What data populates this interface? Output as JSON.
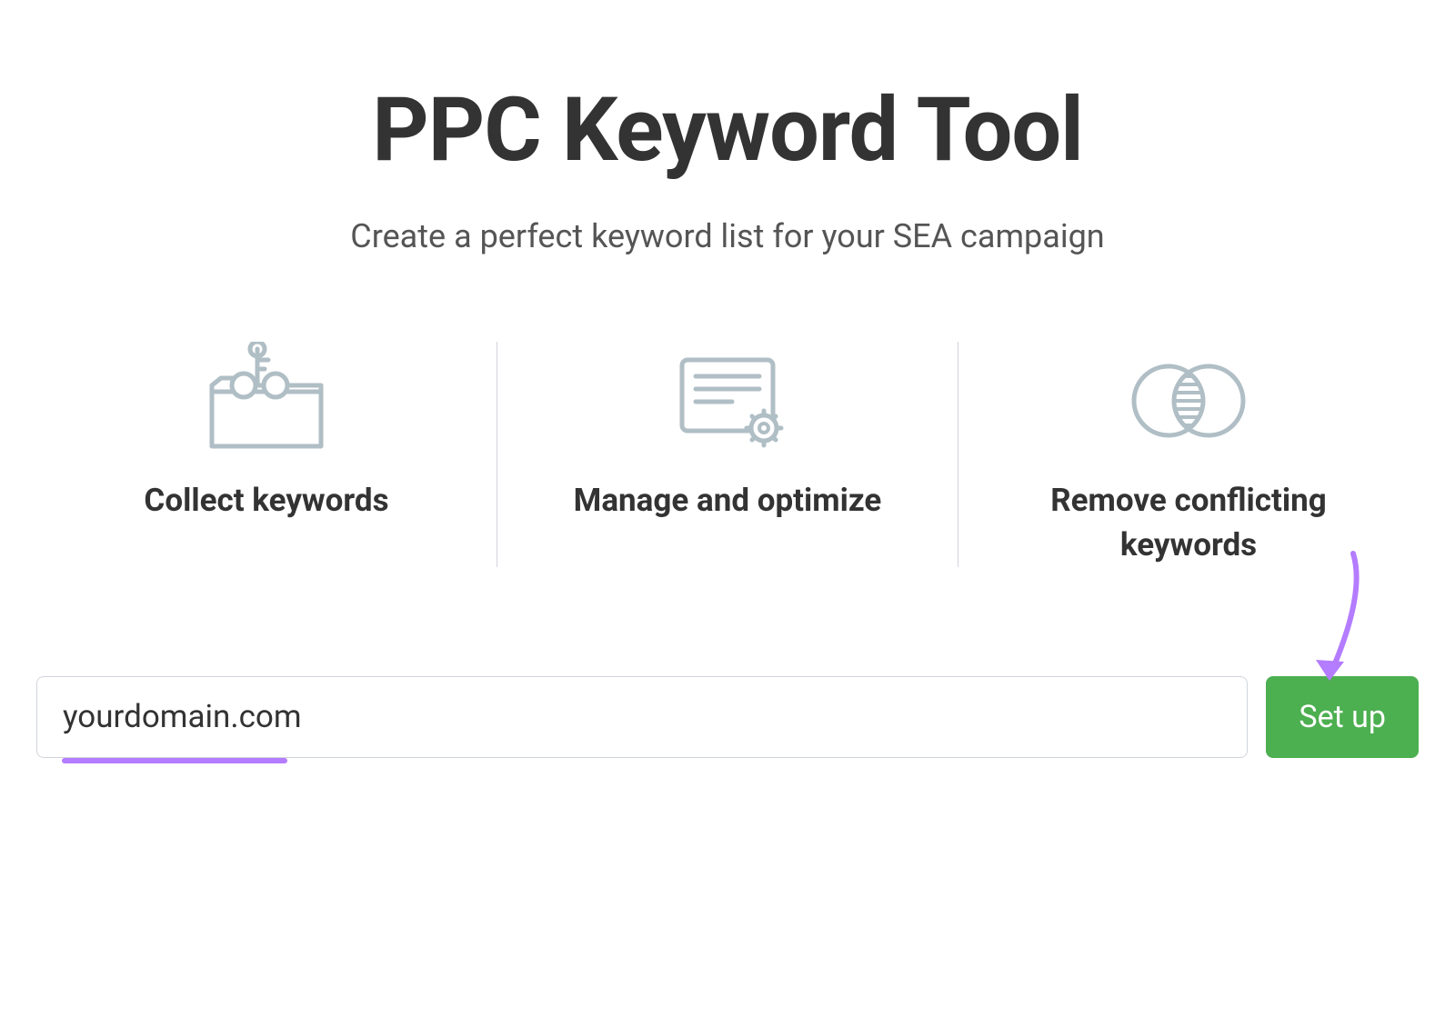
{
  "header": {
    "title": "PPC Keyword Tool",
    "subtitle": "Create a perfect keyword list for your SEA campaign"
  },
  "features": [
    {
      "icon": "collect-keywords-icon",
      "label": "Collect keywords"
    },
    {
      "icon": "manage-optimize-icon",
      "label": "Manage and optimize"
    },
    {
      "icon": "remove-conflicts-icon",
      "label": "Remove conflicting keywords"
    }
  ],
  "form": {
    "domain_value": "yourdomain.com",
    "setup_label": "Set up"
  },
  "colors": {
    "accent_purple": "#b47cff",
    "button_green": "#4caf50",
    "icon_stroke": "#b0bec5"
  }
}
